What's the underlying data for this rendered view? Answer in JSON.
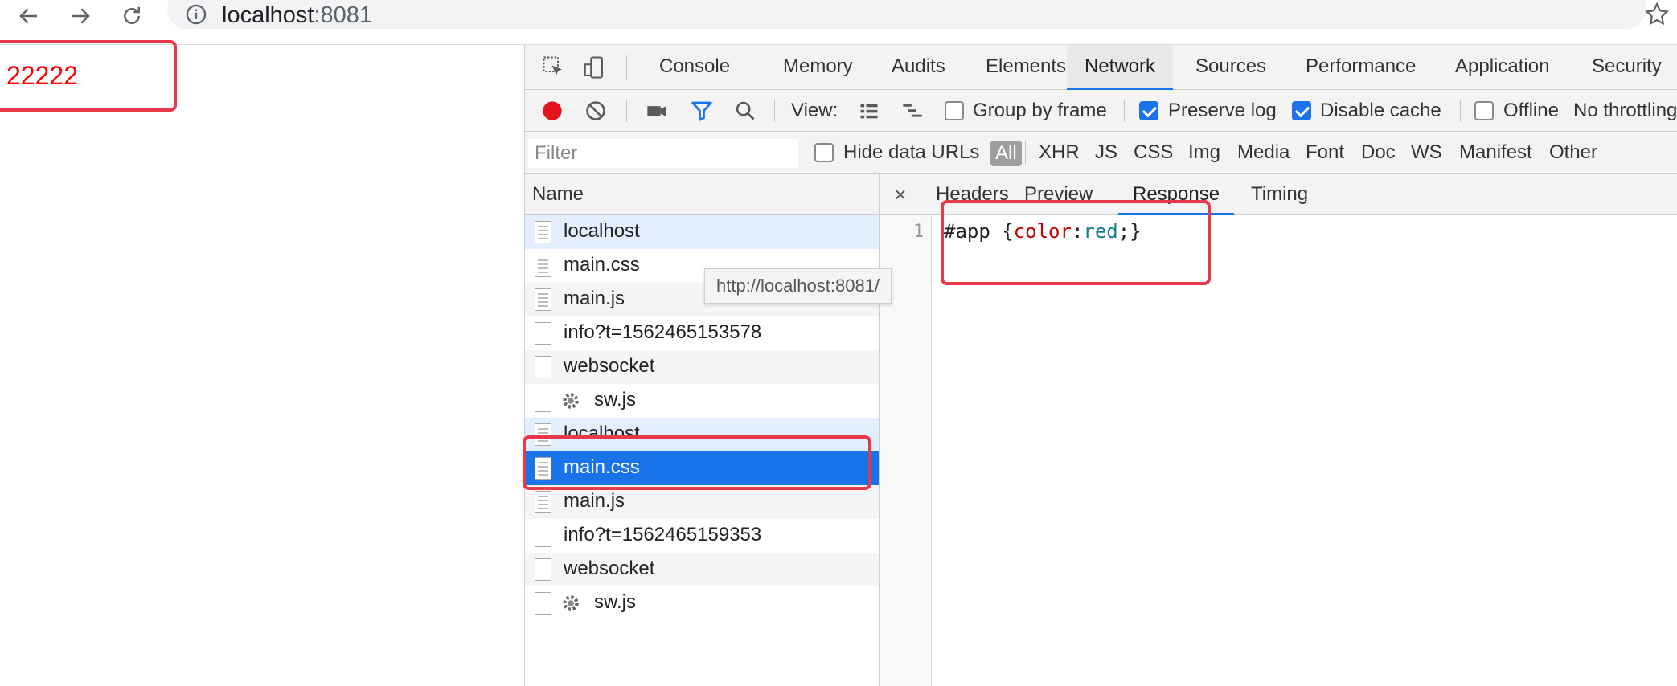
{
  "browser": {
    "url_host": "localhost",
    "url_port": ":8081",
    "icons": [
      "back-arrow-icon",
      "forward-arrow-icon",
      "reload-icon",
      "info-icon",
      "bookmark-star-icon"
    ]
  },
  "page": {
    "text": "22222",
    "text_color": "#ff0000"
  },
  "devtools": {
    "tabs": [
      "Console",
      "Memory",
      "Audits",
      "Elements",
      "Network",
      "Sources",
      "Performance",
      "Application",
      "Security"
    ],
    "active_tab": "Network",
    "toolbar": {
      "view_label": "View:",
      "group_by_frame": {
        "label": "Group by frame",
        "checked": false
      },
      "preserve_log": {
        "label": "Preserve log",
        "checked": true
      },
      "disable_cache": {
        "label": "Disable cache",
        "checked": true
      },
      "offline": {
        "label": "Offline",
        "checked": false
      },
      "throttling": "No throttling"
    },
    "filterbar": {
      "placeholder": "Filter",
      "hide_data_urls": {
        "label": "Hide data URLs",
        "checked": false
      },
      "types": [
        "All",
        "XHR",
        "JS",
        "CSS",
        "Img",
        "Media",
        "Font",
        "Doc",
        "WS",
        "Manifest",
        "Other"
      ],
      "active_type": "All"
    },
    "request_list": {
      "header": "Name",
      "rows": [
        {
          "name": "localhost",
          "icon": "document-icon",
          "state": "highlighted"
        },
        {
          "name": "main.css",
          "icon": "document-icon",
          "state": "normal"
        },
        {
          "name": "main.js",
          "icon": "document-icon",
          "state": "normal"
        },
        {
          "name": "info?t=1562465153578",
          "icon": "blank-file-icon",
          "state": "normal"
        },
        {
          "name": "websocket",
          "icon": "blank-file-icon",
          "state": "normal"
        },
        {
          "name": "sw.js",
          "icon": "gear-icon",
          "state": "normal"
        },
        {
          "name": "localhost",
          "icon": "document-icon",
          "state": "highlighted"
        },
        {
          "name": "main.css",
          "icon": "document-icon",
          "state": "selected"
        },
        {
          "name": "main.js",
          "icon": "document-icon",
          "state": "normal"
        },
        {
          "name": "info?t=1562465159353",
          "icon": "blank-file-icon",
          "state": "normal"
        },
        {
          "name": "websocket",
          "icon": "blank-file-icon",
          "state": "normal"
        },
        {
          "name": "sw.js",
          "icon": "gear-icon",
          "state": "normal"
        }
      ],
      "tooltip": "http://localhost:8081/"
    },
    "detail": {
      "close_label": "×",
      "tabs": [
        "Headers",
        "Preview",
        "Response",
        "Timing"
      ],
      "active_tab": "Response",
      "line_number": "1",
      "code": {
        "selector": "#app {",
        "property": "color",
        "colon": ":",
        "value": "red",
        "end": ";}"
      }
    }
  },
  "colors": {
    "accent": "#1a73e8",
    "record": "#e3141b",
    "annotation": "#e8394a"
  }
}
